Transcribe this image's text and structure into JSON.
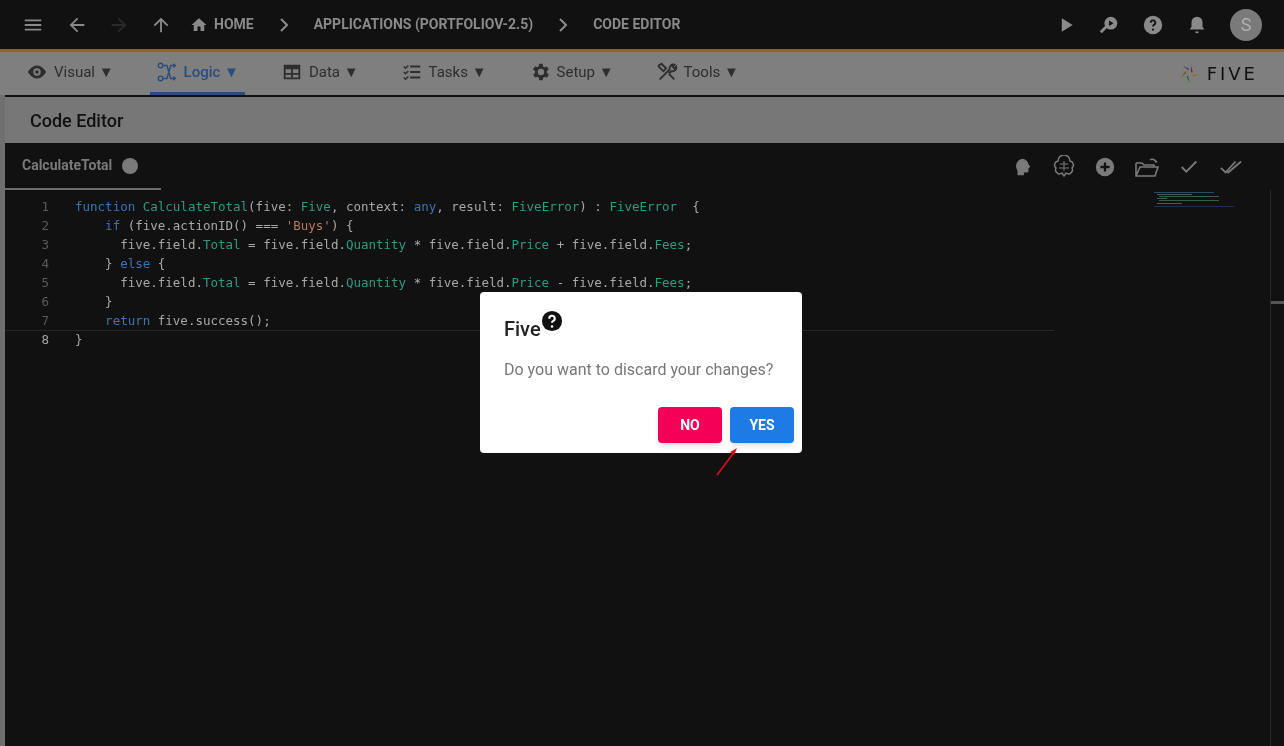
{
  "top_bar": {
    "breadcrumbs": [
      {
        "label": "HOME",
        "kind": "home"
      },
      {
        "label": "APPLICATIONS (PORTFOLIOV-2.5)",
        "kind": "plain"
      },
      {
        "label": "CODE EDITOR",
        "kind": "plain"
      }
    ],
    "avatar": "S",
    "forward_disabled": true
  },
  "menu": [
    {
      "label": "Visual ▼",
      "selected": false
    },
    {
      "label": "Logic ▼",
      "selected": true
    },
    {
      "label": "Data ▼",
      "selected": false
    },
    {
      "label": "Tasks ▼",
      "selected": false
    },
    {
      "label": "Setup ▼",
      "selected": false
    },
    {
      "label": "Tools ▼",
      "selected": false
    }
  ],
  "logo": "FIVE",
  "page_title": "Code Editor",
  "editor": {
    "tab": {
      "label": "CalculateTotal",
      "modified": true
    },
    "lines": [
      {
        "number": "1",
        "segments": [
          {
            "text": "function ",
            "kind": "keyword"
          },
          {
            "text": "CalculateTotal",
            "kind": "type"
          },
          {
            "text": "(five: ",
            "kind": "plain"
          },
          {
            "text": "Five",
            "kind": "type"
          },
          {
            "text": ", context: ",
            "kind": "plain"
          },
          {
            "text": "any",
            "kind": "keyword"
          },
          {
            "text": ", result: ",
            "kind": "plain"
          },
          {
            "text": "FiveError",
            "kind": "type"
          },
          {
            "text": ") : ",
            "kind": "plain"
          },
          {
            "text": "FiveError",
            "kind": "type"
          },
          {
            "text": "  {",
            "kind": "plain"
          }
        ]
      },
      {
        "number": "2",
        "segments": [
          {
            "text": "    if",
            "kind": "keyword"
          },
          {
            "text": " (five.actionID() === ",
            "kind": "plain"
          },
          {
            "text": "'Buys'",
            "kind": "string"
          },
          {
            "text": ") {",
            "kind": "plain"
          }
        ]
      },
      {
        "number": "3",
        "segments": [
          {
            "text": "      five.field.",
            "kind": "plain"
          },
          {
            "text": "Total",
            "kind": "type"
          },
          {
            "text": " = five.field.",
            "kind": "plain"
          },
          {
            "text": "Quantity",
            "kind": "type"
          },
          {
            "text": " * five.field.",
            "kind": "plain"
          },
          {
            "text": "Price",
            "kind": "type"
          },
          {
            "text": " + five.field.",
            "kind": "plain"
          },
          {
            "text": "Fees",
            "kind": "type"
          },
          {
            "text": ";",
            "kind": "plain"
          }
        ]
      },
      {
        "number": "4",
        "segments": [
          {
            "text": "    } ",
            "kind": "plain"
          },
          {
            "text": "else",
            "kind": "keyword"
          },
          {
            "text": " {",
            "kind": "plain"
          }
        ]
      },
      {
        "number": "5",
        "segments": [
          {
            "text": "      five.field.",
            "kind": "plain"
          },
          {
            "text": "Total",
            "kind": "type"
          },
          {
            "text": " = five.field.",
            "kind": "plain"
          },
          {
            "text": "Quantity",
            "kind": "type"
          },
          {
            "text": " * five.field.",
            "kind": "plain"
          },
          {
            "text": "Price",
            "kind": "type"
          },
          {
            "text": " - five.field.",
            "kind": "plain"
          },
          {
            "text": "Fees",
            "kind": "type"
          },
          {
            "text": ";",
            "kind": "plain"
          }
        ]
      },
      {
        "number": "6",
        "segments": [
          {
            "text": "    }",
            "kind": "plain"
          }
        ]
      },
      {
        "number": "7",
        "segments": [
          {
            "text": "    return",
            "kind": "keyword"
          },
          {
            "text": " five.success();",
            "kind": "plain"
          }
        ]
      },
      {
        "number": "8",
        "segments": [
          {
            "text": "}",
            "kind": "plain"
          }
        ]
      }
    ]
  },
  "dialog": {
    "title": "Five",
    "message": "Do you want to discard your changes?",
    "buttons": [
      {
        "label": "NO",
        "kind": "cancel"
      },
      {
        "label": "YES",
        "kind": "confirm"
      }
    ]
  }
}
